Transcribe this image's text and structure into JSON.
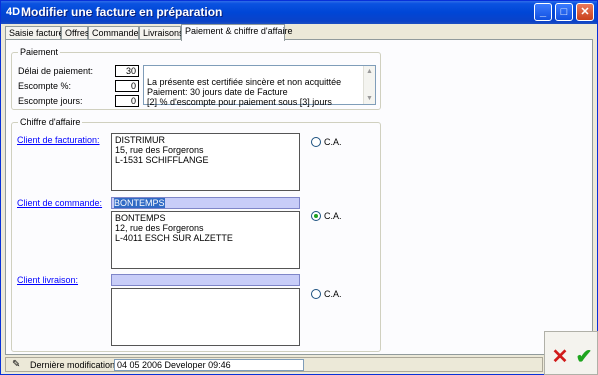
{
  "window": {
    "logo": "4D",
    "title": "Modifier une facture en préparation",
    "controls": {
      "minimize": "_",
      "maximize": "□",
      "close": "✕"
    }
  },
  "tabs": [
    {
      "label": "Saisie facture"
    },
    {
      "label": "Offres"
    },
    {
      "label": "Commandes"
    },
    {
      "label": "Livraisons"
    },
    {
      "label": "Paiement & chiffre d'affaire",
      "active": true
    }
  ],
  "paiement": {
    "group_title": "Paiement",
    "delai_label": "Délai de paiement:",
    "delai_value": "30",
    "escompte_pct_label": "Escompte %:",
    "escompte_pct_value": "0",
    "escompte_jours_label": "Escompte jours:",
    "escompte_jours_value": "0",
    "note_text": "La présente est certifiée sincère et non acquittée\nPaiement: 30 jours date de Facture\n[2] % d'escompte pour paiement sous [3] jours"
  },
  "chiffre": {
    "group_title": "Chiffre d'affaire",
    "facturation_label": "Client de facturation:",
    "facturation_address": "DISTRIMUR\n15, rue des Forgerons\nL-1531 SCHIFFLANGE",
    "facturation_ca_label": "C.A.",
    "facturation_ca_checked": false,
    "commande_label": "Client de commande:",
    "commande_field": "BONTEMPS",
    "commande_address": "BONTEMPS\n12, rue des Forgerons\nL-4011 ESCH SUR ALZETTE",
    "commande_ca_label": "C.A.",
    "commande_ca_checked": true,
    "livraison_label": "Client livraison:",
    "livraison_field": "",
    "livraison_address": "",
    "livraison_ca_label": "C.A.",
    "livraison_ca_checked": false
  },
  "status": {
    "label": "Dernière modification:",
    "value": "04 05 2006 Developer 09:46"
  },
  "actions": {
    "cancel": "✕",
    "ok": "✔"
  },
  "colors": {
    "titlebar": "#0046d6",
    "panel_bg": "#ece9d8",
    "field_highlight": "#c8cdf8",
    "cancel": "#d11b1b",
    "ok": "#1ea51e"
  }
}
